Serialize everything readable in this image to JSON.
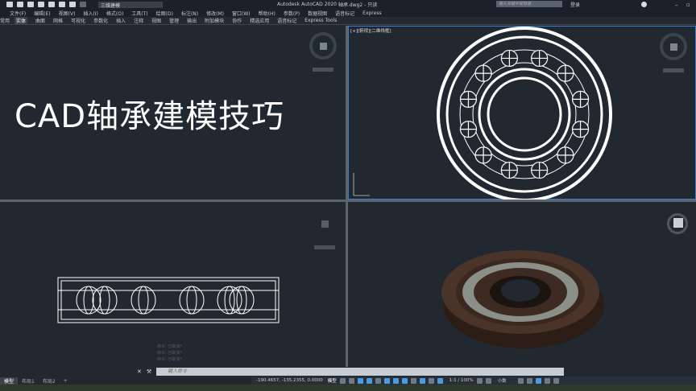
{
  "titlebar": {
    "workspace": "三维建模",
    "app_title": "Autodesk AutoCAD 2020",
    "file": "轴承.dwg2 - 只读",
    "search_placeholder": "键入关键字或短语",
    "login": "登录"
  },
  "menu": [
    "文件(F)",
    "编辑(E)",
    "视图(V)",
    "插入(I)",
    "格式(O)",
    "工具(T)",
    "绘图(D)",
    "标注(N)",
    "修改(M)",
    "窗口(W)",
    "帮助(H)",
    "参数(P)",
    "数据视图",
    "语音标记",
    "Express"
  ],
  "ribbon_tabs": [
    "常用",
    "实体",
    "曲面",
    "网格",
    "可视化",
    "参数化",
    "插入",
    "注释",
    "视图",
    "管理",
    "输出",
    "附加模块",
    "协作",
    "精选应用",
    "语音标记",
    "Express Tools"
  ],
  "overlay_title": "CAD轴承建模技巧",
  "viewport_label": "[+][俯视][二维线框]",
  "command": {
    "placeholder": "键入命令",
    "history": [
      "命令: 已取消*",
      "命令: 已取消*",
      "命令: 已取消*"
    ]
  },
  "layout_tabs": [
    "模型",
    "布局1",
    "布局2",
    "+"
  ],
  "status": {
    "coords": "-190.4657, -135.2355, 0.0000",
    "model": "模型",
    "scale": "1:1 / 100%",
    "units": "小数"
  }
}
